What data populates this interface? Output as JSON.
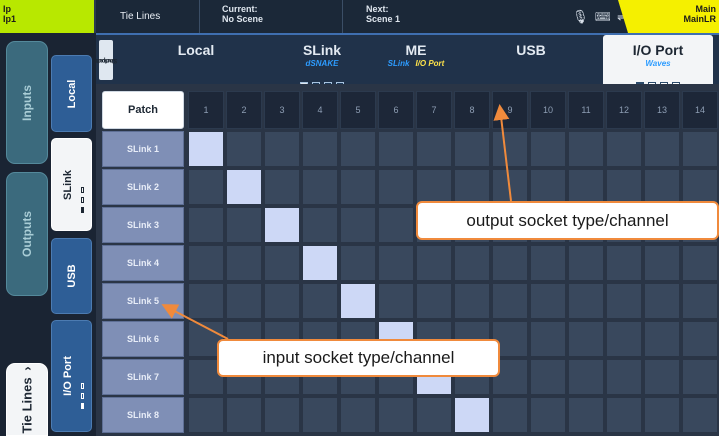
{
  "top_bar": {
    "left_channel": [
      "Ip",
      "Ip1"
    ],
    "page_title": "Tie Lines",
    "current": {
      "label": "Current:",
      "value": "No Scene"
    },
    "next": {
      "label": "Next:",
      "value": "Scene 1"
    },
    "status_icons": [
      "microphone-icon",
      "keyboard-icon",
      "usb-icon"
    ],
    "right_channel": [
      "Main",
      "MainLR"
    ]
  },
  "nav": {
    "main_tabs": [
      {
        "label": "Inputs",
        "active": false
      },
      {
        "label": "Outputs",
        "active": false
      },
      {
        "label": "Tie Lines",
        "active": true,
        "chevron": "›"
      }
    ],
    "sub_tabs": [
      {
        "label": "Local",
        "active": false
      },
      {
        "label": "SLink",
        "active": true
      },
      {
        "label": "USB",
        "active": false
      },
      {
        "label": "I/O Port",
        "active": false
      }
    ]
  },
  "socket_header": {
    "side_label": [
      "Output",
      "Sockets"
    ],
    "types": [
      {
        "name": "Local",
        "sub": "",
        "sub_hl": "",
        "dots": 0,
        "active_dot": -1,
        "active": false
      },
      {
        "name": "SLink",
        "sub": "dSNAKE",
        "sub_hl": "",
        "dots": 4,
        "active_dot": 0,
        "active": false
      },
      {
        "name": "ME",
        "sub": "SLink",
        "sub_hl": "I/O Port",
        "dots": 0,
        "active_dot": -1,
        "active": false
      },
      {
        "name": "USB",
        "sub": "",
        "sub_hl": "",
        "dots": 0,
        "active_dot": -1,
        "active": false
      },
      {
        "name": "I/O Port",
        "sub": "Waves",
        "sub_hl": "",
        "dots": 4,
        "active_dot": 0,
        "active": true
      }
    ]
  },
  "grid": {
    "patch_label": "Patch",
    "columns": [
      "1",
      "2",
      "3",
      "4",
      "5",
      "6",
      "7",
      "8",
      "9",
      "10",
      "11",
      "12",
      "13",
      "14"
    ],
    "rows": [
      "SLink 1",
      "SLink 2",
      "SLink 3",
      "SLink 4",
      "SLink 5",
      "SLink 6",
      "SLink 7",
      "SLink 8"
    ],
    "patched": [
      [
        0,
        0
      ],
      [
        1,
        1
      ],
      [
        2,
        2
      ],
      [
        3,
        3
      ],
      [
        4,
        4
      ],
      [
        5,
        5
      ],
      [
        6,
        6
      ],
      [
        7,
        7
      ]
    ]
  },
  "annotations": {
    "output_callout": "output socket type/channel",
    "input_callout": "input socket type/channel",
    "arrow_color": "#f08a3c"
  },
  "colors": {
    "accent_blue": "#2d9cff",
    "patched_cell": "#cdd8f6",
    "green_channel": "#b8e800",
    "yellow_channel": "#f5f000"
  }
}
